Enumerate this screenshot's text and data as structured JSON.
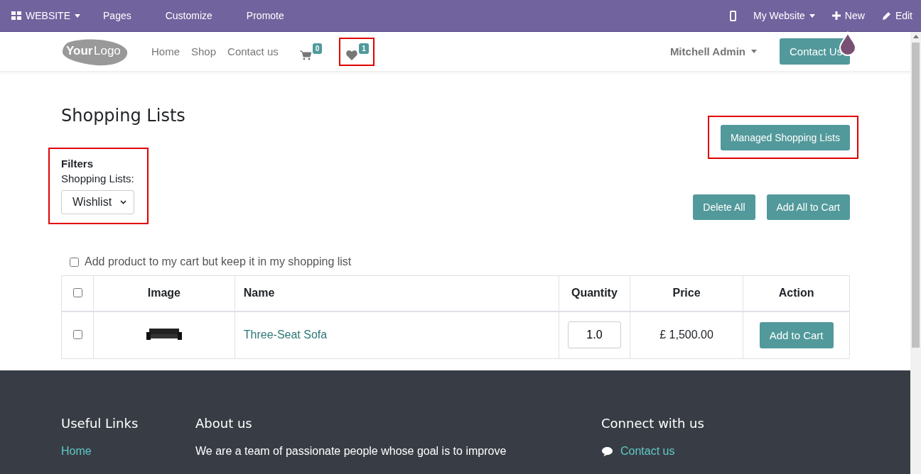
{
  "admin_bar": {
    "app_menu": "WEBSITE",
    "left_items": [
      "Pages",
      "Customize",
      "Promote"
    ],
    "website_menu": "My Website",
    "new_label": "New",
    "edit_label": "Edit"
  },
  "header": {
    "logo": [
      "Your",
      "Logo"
    ],
    "nav": [
      {
        "label": "Home"
      },
      {
        "label": "Shop"
      },
      {
        "label": "Contact us"
      }
    ],
    "cart_count": "0",
    "wishlist_count": "1",
    "user": "Mitchell Admin",
    "cta": "Contact Us"
  },
  "page": {
    "title": "Shopping Lists",
    "managed_button": "Managed Shopping Lists",
    "filters": {
      "heading": "Filters",
      "label": "Shopping Lists:",
      "value": "Wishlist"
    },
    "delete_all": "Delete All",
    "add_all": "Add All to Cart",
    "keep_option": {
      "label": "Add product to my cart but keep it in my shopping list",
      "checked": false
    }
  },
  "table": {
    "select_all_checked": false,
    "columns": [
      "Image",
      "Name",
      "Quantity",
      "Price",
      "Action"
    ],
    "rows": [
      {
        "checked": false,
        "name": "Three-Seat Sofa",
        "quantity": "1.0",
        "price": "£ 1,500.00",
        "action": "Add to Cart"
      }
    ]
  },
  "footer": {
    "columns": [
      {
        "heading": "Useful Links",
        "text": "Home",
        "kind": "link"
      },
      {
        "heading": "About us",
        "text": "We are a team of passionate people whose goal is to improve",
        "kind": "text"
      },
      {
        "heading": "Connect with us",
        "text": "Contact us",
        "kind": "contact"
      }
    ]
  }
}
